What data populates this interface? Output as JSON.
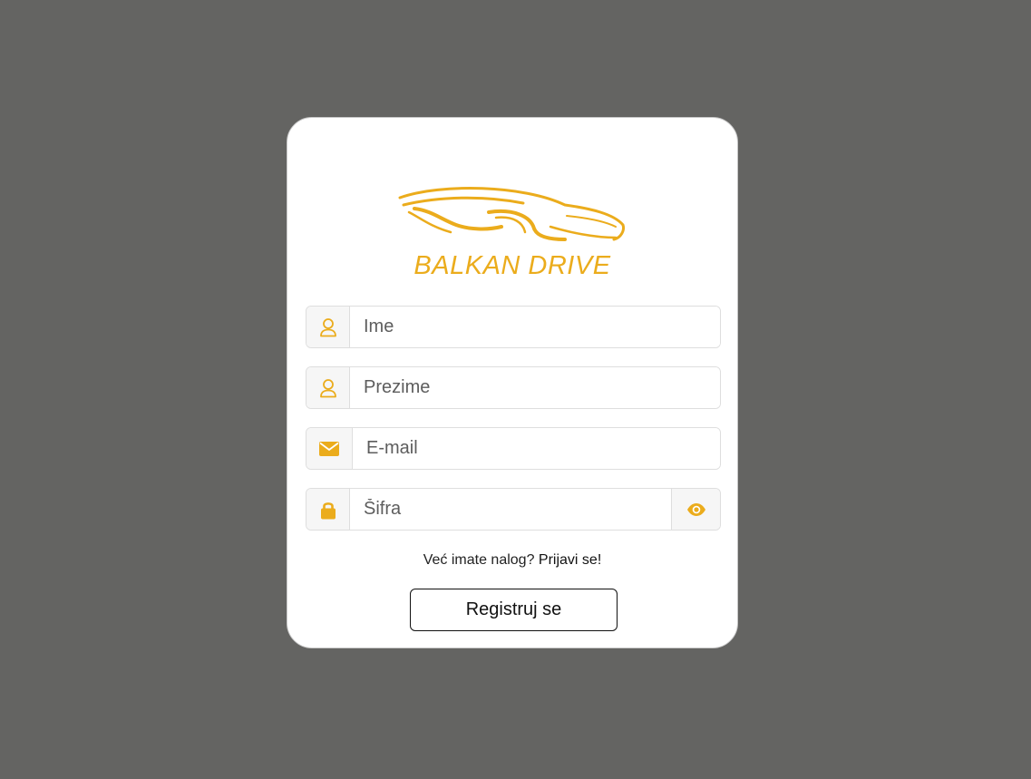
{
  "brand": {
    "logo_text": "BALKAN DRIVE",
    "accent_color": "#ebac1c"
  },
  "form": {
    "first_name": {
      "placeholder": "Ime",
      "value": "",
      "icon": "user-icon"
    },
    "last_name": {
      "placeholder": "Prezime",
      "value": "",
      "icon": "user-icon"
    },
    "email": {
      "placeholder": "E-mail",
      "value": "",
      "icon": "envelope-icon"
    },
    "password": {
      "placeholder": "Šifra",
      "value": "",
      "icon": "lock-icon",
      "toggle_icon": "eye-icon"
    }
  },
  "login_prompt": {
    "text": "Već imate nalog? ",
    "link": "Prijavi se!"
  },
  "submit": {
    "label": "Registruj se"
  },
  "colors": {
    "background": "#646462",
    "card": "#ffffff",
    "icon": "#ebac1c"
  }
}
